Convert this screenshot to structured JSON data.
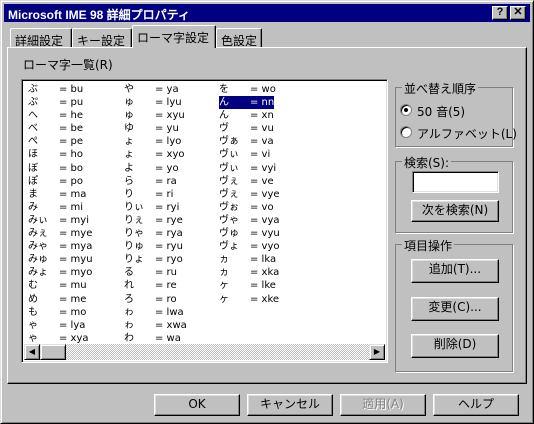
{
  "window": {
    "title": "Microsoft IME 98 詳細プロパティ",
    "help_button": "?",
    "close_button": "✕"
  },
  "tabs": [
    {
      "label": "詳細設定"
    },
    {
      "label": "キー設定"
    },
    {
      "label": "ローマ字設定"
    },
    {
      "label": "色設定"
    }
  ],
  "list_label": "ローマ字一覧(R)",
  "romaji_columns": [
    [
      {
        "kana": "ぶ",
        "romaji": "= bu"
      },
      {
        "kana": "ぷ",
        "romaji": "= pu"
      },
      {
        "kana": "へ",
        "romaji": "= he"
      },
      {
        "kana": "べ",
        "romaji": "= be"
      },
      {
        "kana": "ぺ",
        "romaji": "= pe"
      },
      {
        "kana": "ほ",
        "romaji": "= ho"
      },
      {
        "kana": "ぼ",
        "romaji": "= bo"
      },
      {
        "kana": "ぽ",
        "romaji": "= po"
      },
      {
        "kana": "ま",
        "romaji": "= ma"
      },
      {
        "kana": "み",
        "romaji": "= mi"
      },
      {
        "kana": "みぃ",
        "romaji": "= myi"
      },
      {
        "kana": "みぇ",
        "romaji": "= mye"
      },
      {
        "kana": "みゃ",
        "romaji": "= mya"
      },
      {
        "kana": "みゅ",
        "romaji": "= myu"
      },
      {
        "kana": "みょ",
        "romaji": "= myo"
      },
      {
        "kana": "む",
        "romaji": "= mu"
      },
      {
        "kana": "め",
        "romaji": "= me"
      },
      {
        "kana": "も",
        "romaji": "= mo"
      },
      {
        "kana": "ゃ",
        "romaji": "= lya"
      },
      {
        "kana": "ゃ",
        "romaji": "= xya"
      }
    ],
    [
      {
        "kana": "や",
        "romaji": "= ya"
      },
      {
        "kana": "ゅ",
        "romaji": "= lyu"
      },
      {
        "kana": "ゅ",
        "romaji": "= xyu"
      },
      {
        "kana": "ゆ",
        "romaji": "= yu"
      },
      {
        "kana": "ょ",
        "romaji": "= lyo"
      },
      {
        "kana": "ょ",
        "romaji": "= xyo"
      },
      {
        "kana": "よ",
        "romaji": "= yo"
      },
      {
        "kana": "ら",
        "romaji": "= ra"
      },
      {
        "kana": "り",
        "romaji": "= ri"
      },
      {
        "kana": "りぃ",
        "romaji": "= ryi"
      },
      {
        "kana": "りぇ",
        "romaji": "= rye"
      },
      {
        "kana": "りゃ",
        "romaji": "= rya"
      },
      {
        "kana": "りゅ",
        "romaji": "= ryu"
      },
      {
        "kana": "りょ",
        "romaji": "= ryo"
      },
      {
        "kana": "る",
        "romaji": "= ru"
      },
      {
        "kana": "れ",
        "romaji": "= re"
      },
      {
        "kana": "ろ",
        "romaji": "= ro"
      },
      {
        "kana": "ゎ",
        "romaji": "= lwa"
      },
      {
        "kana": "ゎ",
        "romaji": "= xwa"
      },
      {
        "kana": "わ",
        "romaji": "= wa"
      }
    ],
    [
      {
        "kana": "を",
        "romaji": "= wo"
      },
      {
        "kana": "ん",
        "romaji": "= nn",
        "selected": true
      },
      {
        "kana": "ん",
        "romaji": "= xn"
      },
      {
        "kana": "ヴ",
        "romaji": "= vu"
      },
      {
        "kana": "ヴぁ",
        "romaji": "= va"
      },
      {
        "kana": "ヴぃ",
        "romaji": "= vi"
      },
      {
        "kana": "ヴぃ",
        "romaji": "= vyi"
      },
      {
        "kana": "ヴぇ",
        "romaji": "= ve"
      },
      {
        "kana": "ヴぇ",
        "romaji": "= vye"
      },
      {
        "kana": "ヴぉ",
        "romaji": "= vo"
      },
      {
        "kana": "ヴゃ",
        "romaji": "= vya"
      },
      {
        "kana": "ヴゅ",
        "romaji": "= vyu"
      },
      {
        "kana": "ヴょ",
        "romaji": "= vyo"
      },
      {
        "kana": "ヵ",
        "romaji": "= lka"
      },
      {
        "kana": "ヵ",
        "romaji": "= xka"
      },
      {
        "kana": "ヶ",
        "romaji": "= lke"
      },
      {
        "kana": "ヶ",
        "romaji": "= xke"
      }
    ]
  ],
  "sort_group": {
    "label": "並べ替え順序",
    "options": [
      {
        "label": "50 音(5)",
        "selected": true
      },
      {
        "label": "アルファベット(L)",
        "selected": false
      }
    ]
  },
  "search_group": {
    "label": "検索(S):",
    "value": "",
    "next_button": "次を検索(N)"
  },
  "ops_group": {
    "label": "項目操作",
    "add_button": "追加(T)...",
    "change_button": "変更(C)...",
    "delete_button": "削除(D)"
  },
  "footer": {
    "ok": "OK",
    "cancel": "キャンセル",
    "apply": "適用(A)",
    "help": "ヘルプ"
  },
  "colors": {
    "title_bar": "#000080",
    "face": "#c0c0c0",
    "selection": "#000080"
  }
}
